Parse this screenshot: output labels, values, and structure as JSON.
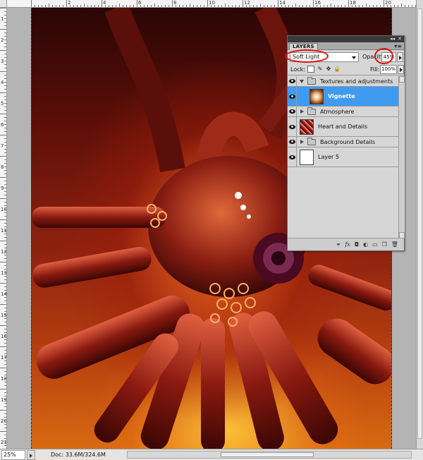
{
  "window": {
    "title_controls": [
      "◂◂",
      "✕"
    ]
  },
  "layers_panel": {
    "tab_label": "LAYERS",
    "menu_icon": "panel-menu-icon",
    "blend_mode": "Soft Light",
    "opacity_label": "Opacity:",
    "opacity_value": "45%",
    "lock_label": "Lock:",
    "fill_label": "Fill:",
    "fill_value": "100%",
    "layers": [
      {
        "name": "Textures and adjustments",
        "type": "group",
        "expanded": true,
        "visible": true
      },
      {
        "name": "Vignette",
        "type": "layer",
        "selected": true,
        "visible": true,
        "thumbnail": "vignette"
      },
      {
        "name": "Atmosphere",
        "type": "group",
        "expanded": false,
        "visible": true
      },
      {
        "name": "Heart and Details",
        "type": "layer",
        "visible": true,
        "thumbnail": "heart"
      },
      {
        "name": "Background Details",
        "type": "group",
        "expanded": false,
        "visible": true
      },
      {
        "name": "Layer 5",
        "type": "layer",
        "visible": true,
        "thumbnail": "white"
      }
    ],
    "bottom_icons": [
      "link-icon",
      "fx-icon",
      "mask-icon",
      "adjustment-icon",
      "group-icon",
      "new-layer-icon",
      "trash-icon"
    ],
    "bottom_glyphs": [
      "⚭",
      "fx",
      "◘",
      "◐",
      "▭",
      "❐",
      "🗑"
    ]
  },
  "status_bar": {
    "zoom": "25%",
    "doc_info": "Doc: 33.6M/324.6M"
  },
  "rulers": {
    "top_labels": [
      "2",
      "4",
      "6",
      "8",
      "10",
      "12",
      "14",
      "16",
      "18",
      "20"
    ],
    "left_labels": [
      "1",
      "2",
      "3",
      "4",
      "5",
      "6",
      "7",
      "8",
      "9",
      "10",
      "11",
      "12",
      "13",
      "14",
      "15",
      "16",
      "17",
      "18",
      "19",
      "20",
      "21"
    ]
  },
  "colors": {
    "selection": "#3f9af0",
    "annotation": "#e01010",
    "artwork_dark": "#2a0606",
    "artwork_glow": "#d86a12"
  }
}
